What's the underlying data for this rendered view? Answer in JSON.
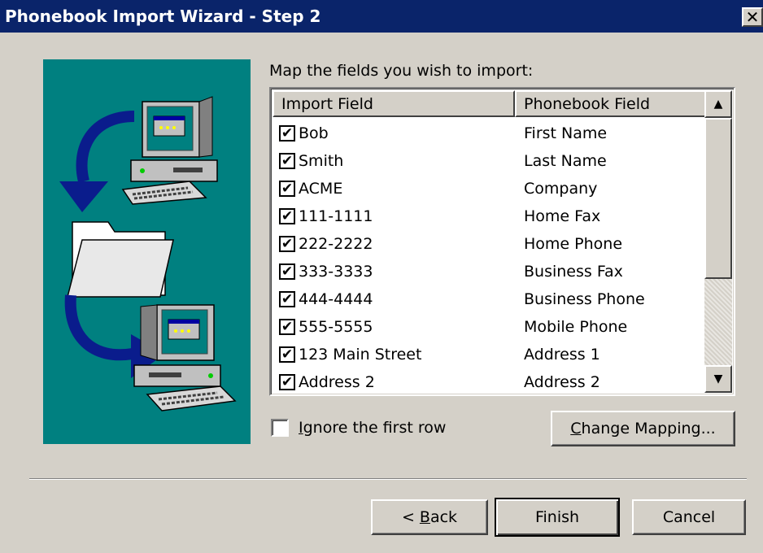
{
  "window": {
    "title": "Phonebook Import Wizard - Step 2",
    "close_glyph": "✕"
  },
  "map_label": "Map the fields you wish to import:",
  "columns": {
    "import_field": "Import Field",
    "phonebook_field": "Phonebook Field"
  },
  "rows": [
    {
      "import": "Bob",
      "phonebook": "First Name",
      "checked": true
    },
    {
      "import": "Smith",
      "phonebook": "Last Name",
      "checked": true
    },
    {
      "import": "ACME",
      "phonebook": "Company",
      "checked": true
    },
    {
      "import": "111-1111",
      "phonebook": "Home Fax",
      "checked": true
    },
    {
      "import": "222-2222",
      "phonebook": "Home Phone",
      "checked": true
    },
    {
      "import": "333-3333",
      "phonebook": "Business Fax",
      "checked": true
    },
    {
      "import": "444-4444",
      "phonebook": "Business Phone",
      "checked": true
    },
    {
      "import": "555-5555",
      "phonebook": "Mobile Phone",
      "checked": true
    },
    {
      "import": "123 Main Street",
      "phonebook": "Address 1",
      "checked": true
    },
    {
      "import": "Address 2",
      "phonebook": "Address 2",
      "checked": true
    }
  ],
  "ignore_first_row": {
    "label_key": "I",
    "label_rest": "gnore the first row",
    "checked": false
  },
  "buttons": {
    "change_mapping_key": "C",
    "change_mapping_rest": "hange Mapping...",
    "back_prefix": "< ",
    "back_key": "B",
    "back_rest": "ack",
    "finish": "Finish",
    "cancel": "Cancel"
  },
  "colors": {
    "titlebar": "#0a246a",
    "dialog_bg": "#d4d0c8",
    "wizard_panel": "#008080",
    "monitor_screen": "#008080",
    "arrow": "#0a1c8c"
  },
  "icons": {
    "wizard_image": [
      "computer-icon",
      "arrow-icon",
      "folder-icon",
      "arrow-icon",
      "computer-icon"
    ],
    "scroll_up": "▲",
    "scroll_down": "▼",
    "check": "✔"
  }
}
